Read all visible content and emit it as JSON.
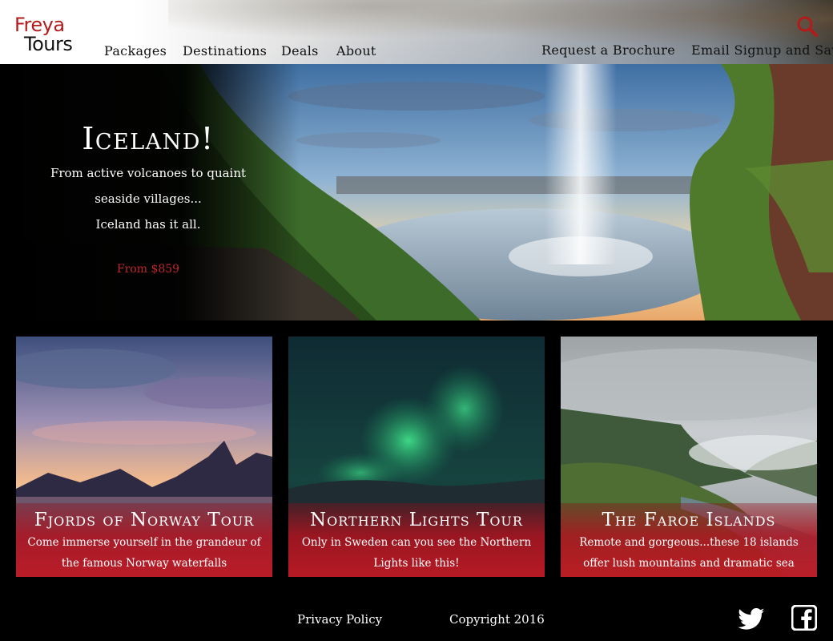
{
  "brand": {
    "line1": "Freya",
    "line2": "Tours"
  },
  "nav": {
    "items": [
      "Packages",
      "Destinations",
      "Deals",
      "About"
    ],
    "brochure": "Request a Brochure",
    "signup": "Email Signup and Save",
    "search_icon": "search-icon"
  },
  "hero": {
    "title": "Iceland!",
    "line1": "From active volcanoes to quaint",
    "line2": "seaside villages...",
    "line3": "Iceland has it all.",
    "price": "From $859"
  },
  "tours": [
    {
      "title": "Fjords of Norway Tour",
      "desc": "Come immerse yourself in the grandeur of the famous Norway waterfalls"
    },
    {
      "title": "Northern Lights Tour",
      "desc": "Only in Sweden can you see the Northern Lights like this!"
    },
    {
      "title": "The Faroe Islands",
      "desc": "Remote and gorgeous...these 18 islands offer lush mountains and dramatic sea views"
    }
  ],
  "footer": {
    "privacy": "Privacy Policy",
    "copyright": "Copyright 2016",
    "social": [
      "twitter-icon",
      "facebook-icon"
    ]
  },
  "colors": {
    "accent": "#b31b1b",
    "caption": "#be1e2d",
    "background": "#000000"
  }
}
